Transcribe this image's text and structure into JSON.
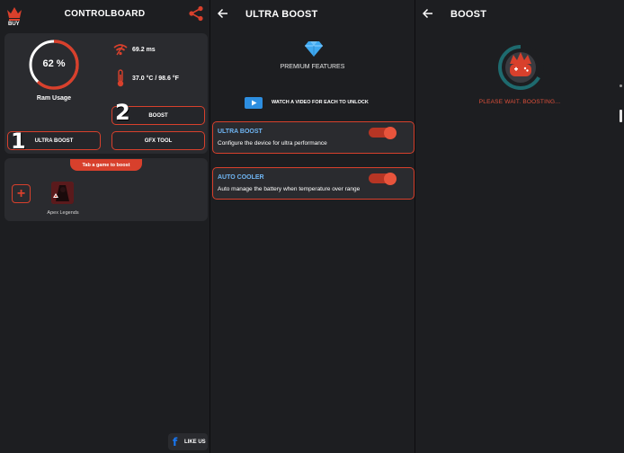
{
  "colors": {
    "accent": "#d8402c",
    "background": "#1d1e21",
    "card": "#2a2b2f",
    "feature_title": "#6fb5f3",
    "progress": "#1e6a6e"
  },
  "controlboard": {
    "buy_label": "BUY",
    "title": "CONTROLBOARD",
    "ram": {
      "percent_text": "62 %",
      "percent": 62,
      "label": "Ram Usage"
    },
    "ping": "69.2 ms",
    "temperature": "37.0 °C / 98.6 °F",
    "buttons": {
      "boost": "BOOST",
      "ultra_boost": "ULTRA BOOST",
      "gfx_tool": "GFX TOOL"
    },
    "steps": {
      "one": "1",
      "two": "2"
    },
    "tab_hint": "Tab a game to boost",
    "add_icon": "plus-icon",
    "games": [
      {
        "name": "Apex Legends"
      }
    ],
    "like_label": "LIKE US"
  },
  "ultra_boost": {
    "title": "ULTRA BOOST",
    "premium_label": "PREMIUM FEATURES",
    "watch_label": "WATCH A VIDEO FOR EACH TO UNLOCK",
    "features": [
      {
        "title": "ULTRA BOOST",
        "description": "Configure the device for ultra performance",
        "enabled": true
      },
      {
        "title": "AUTO COOLER",
        "description": "Auto manage the battery when temperature over range",
        "enabled": true
      }
    ]
  },
  "boost": {
    "title": "BOOST",
    "status": "PLEASE WAIT. BOOSTING..."
  }
}
